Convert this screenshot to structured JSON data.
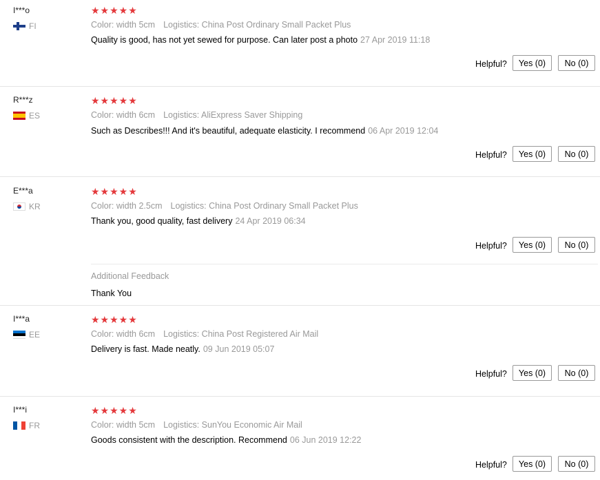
{
  "reviews": [
    {
      "name": "I***o",
      "country": "FI",
      "flag": "fi",
      "stars": "★★★★★",
      "rating": 5,
      "color": "Color: width 5cm",
      "logistics": "Logistics: China Post Ordinary Small Packet Plus",
      "text": "Quality is good, has not yet sewed for purpose. Can later post a photo",
      "time": "27 Apr 2019 11:18",
      "helpful": "Helpful?",
      "yes": "Yes (0)",
      "no": "No (0)"
    },
    {
      "name": "R***z",
      "country": "ES",
      "flag": "es",
      "stars": "★★★★★",
      "rating": 5,
      "color": "Color: width 6cm",
      "logistics": "Logistics: AliExpress Saver Shipping",
      "text": "Such as Describes!!! And it's beautiful, adequate elasticity. I recommend",
      "time": "06 Apr 2019 12:04",
      "helpful": "Helpful?",
      "yes": "Yes (0)",
      "no": "No (0)"
    },
    {
      "name": "E***a",
      "country": "KR",
      "flag": "kr",
      "stars": "★★★★★",
      "rating": 5,
      "color": "Color: width 2.5cm",
      "logistics": "Logistics: China Post Ordinary Small Packet Plus",
      "text": "Thank you, good quality, fast delivery",
      "time": "24 Apr 2019 06:34",
      "helpful": "Helpful?",
      "yes": "Yes (0)",
      "no": "No (0)",
      "additional_title": "Additional Feedback",
      "additional_text": "Thank You"
    },
    {
      "name": "I***a",
      "country": "EE",
      "flag": "ee",
      "stars": "★★★★★",
      "rating": 5,
      "color": "Color: width 6cm",
      "logistics": "Logistics: China Post Registered Air Mail",
      "text": "Delivery is fast. Made neatly.",
      "time": "09 Jun 2019 05:07",
      "helpful": "Helpful?",
      "yes": "Yes (0)",
      "no": "No (0)"
    },
    {
      "name": "I***i",
      "country": "FR",
      "flag": "fr",
      "stars": "★★★★★",
      "rating": 5,
      "color": "Color: width 5cm",
      "logistics": "Logistics: SunYou Economic Air Mail",
      "text": "Goods consistent with the description. Recommend",
      "time": "06 Jun 2019 12:22",
      "helpful": "Helpful?",
      "yes": "Yes (0)",
      "no": "No (0)"
    }
  ],
  "colors": {
    "star": "#e4393c",
    "muted": "#999999",
    "divider": "#e5e5e5"
  }
}
